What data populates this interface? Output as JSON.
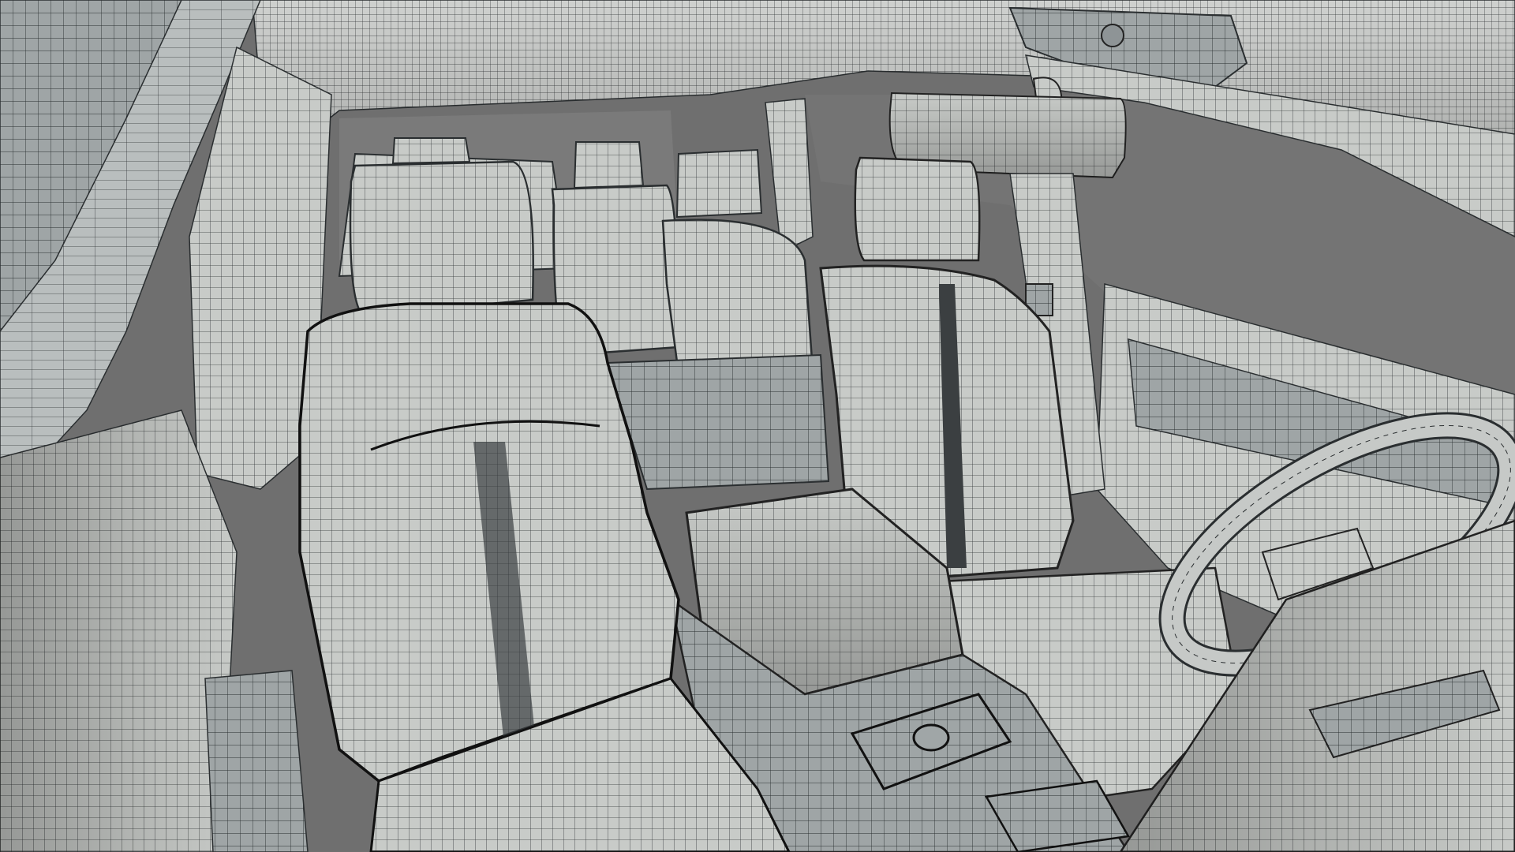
{
  "viewport": {
    "background_color": "#6f6f6f",
    "surface_color": "#c9ccc9",
    "surface_shadow_color": "#9ea3a3",
    "wire_color": "#2a2e30",
    "content": "3d-wireframe-car-interior"
  },
  "scene": {
    "objects": [
      "headliner",
      "rear-window",
      "sunroof-panel",
      "rearview-mirror",
      "grab-handle",
      "a-pillar-left",
      "b-pillar-left",
      "left-door-panel",
      "right-door-panel",
      "third-row-seat",
      "second-row-seat-left",
      "second-row-seat-right",
      "front-seat-left",
      "front-seat-right",
      "center-console-armrest",
      "center-console",
      "console-control-knob",
      "steering-wheel",
      "dashboard",
      "seat-belt-right"
    ]
  }
}
